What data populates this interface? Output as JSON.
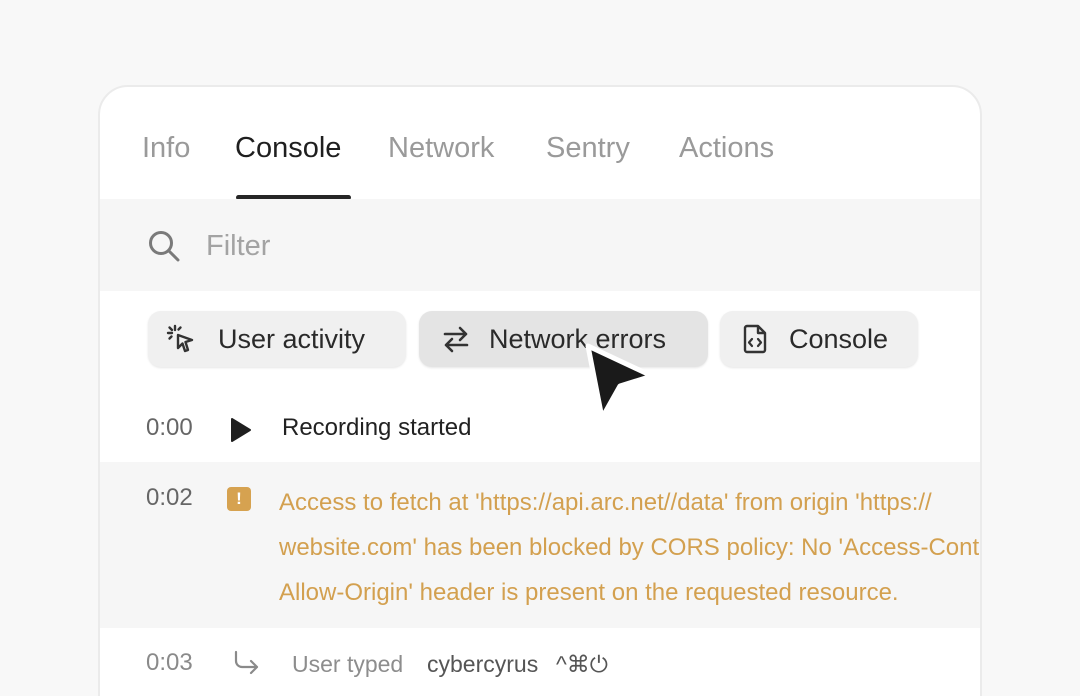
{
  "tabs": [
    {
      "label": "Info"
    },
    {
      "label": "Console"
    },
    {
      "label": "Network"
    },
    {
      "label": "Sentry"
    },
    {
      "label": "Actions"
    }
  ],
  "active_tab": "Console",
  "filter": {
    "placeholder": "Filter",
    "value": ""
  },
  "chips": [
    {
      "label": "User activity",
      "icon": "pointer-click-icon"
    },
    {
      "label": "Network errors",
      "icon": "arrows-exchange-icon",
      "selected": true
    },
    {
      "label": "Console",
      "icon": "code-file-icon"
    }
  ],
  "log": [
    {
      "time": "0:00",
      "icon": "play-icon",
      "text": "Recording started"
    },
    {
      "time": "0:02",
      "icon": "warning-icon",
      "lines": [
        "Access to fetch at 'https://api.arc.net//data' from origin 'https://",
        "website.com' has been blocked by CORS policy: No 'Access-Control-",
        "Allow-Origin' header is present on the requested resource."
      ]
    },
    {
      "time": "0:03",
      "icon": "return-arrow-icon",
      "prefix": "User typed",
      "value": "cybercyrus",
      "keys": "^⌘⏻"
    }
  ],
  "colors": {
    "background": "#f8f8f8",
    "panel": "#ffffff",
    "active_tab": "#1f1f1f",
    "inactive_tab": "#9a9a9a",
    "warning": "#d3a04f",
    "chip": "#f0f0f0",
    "chip_selected": "#e4e4e4"
  }
}
